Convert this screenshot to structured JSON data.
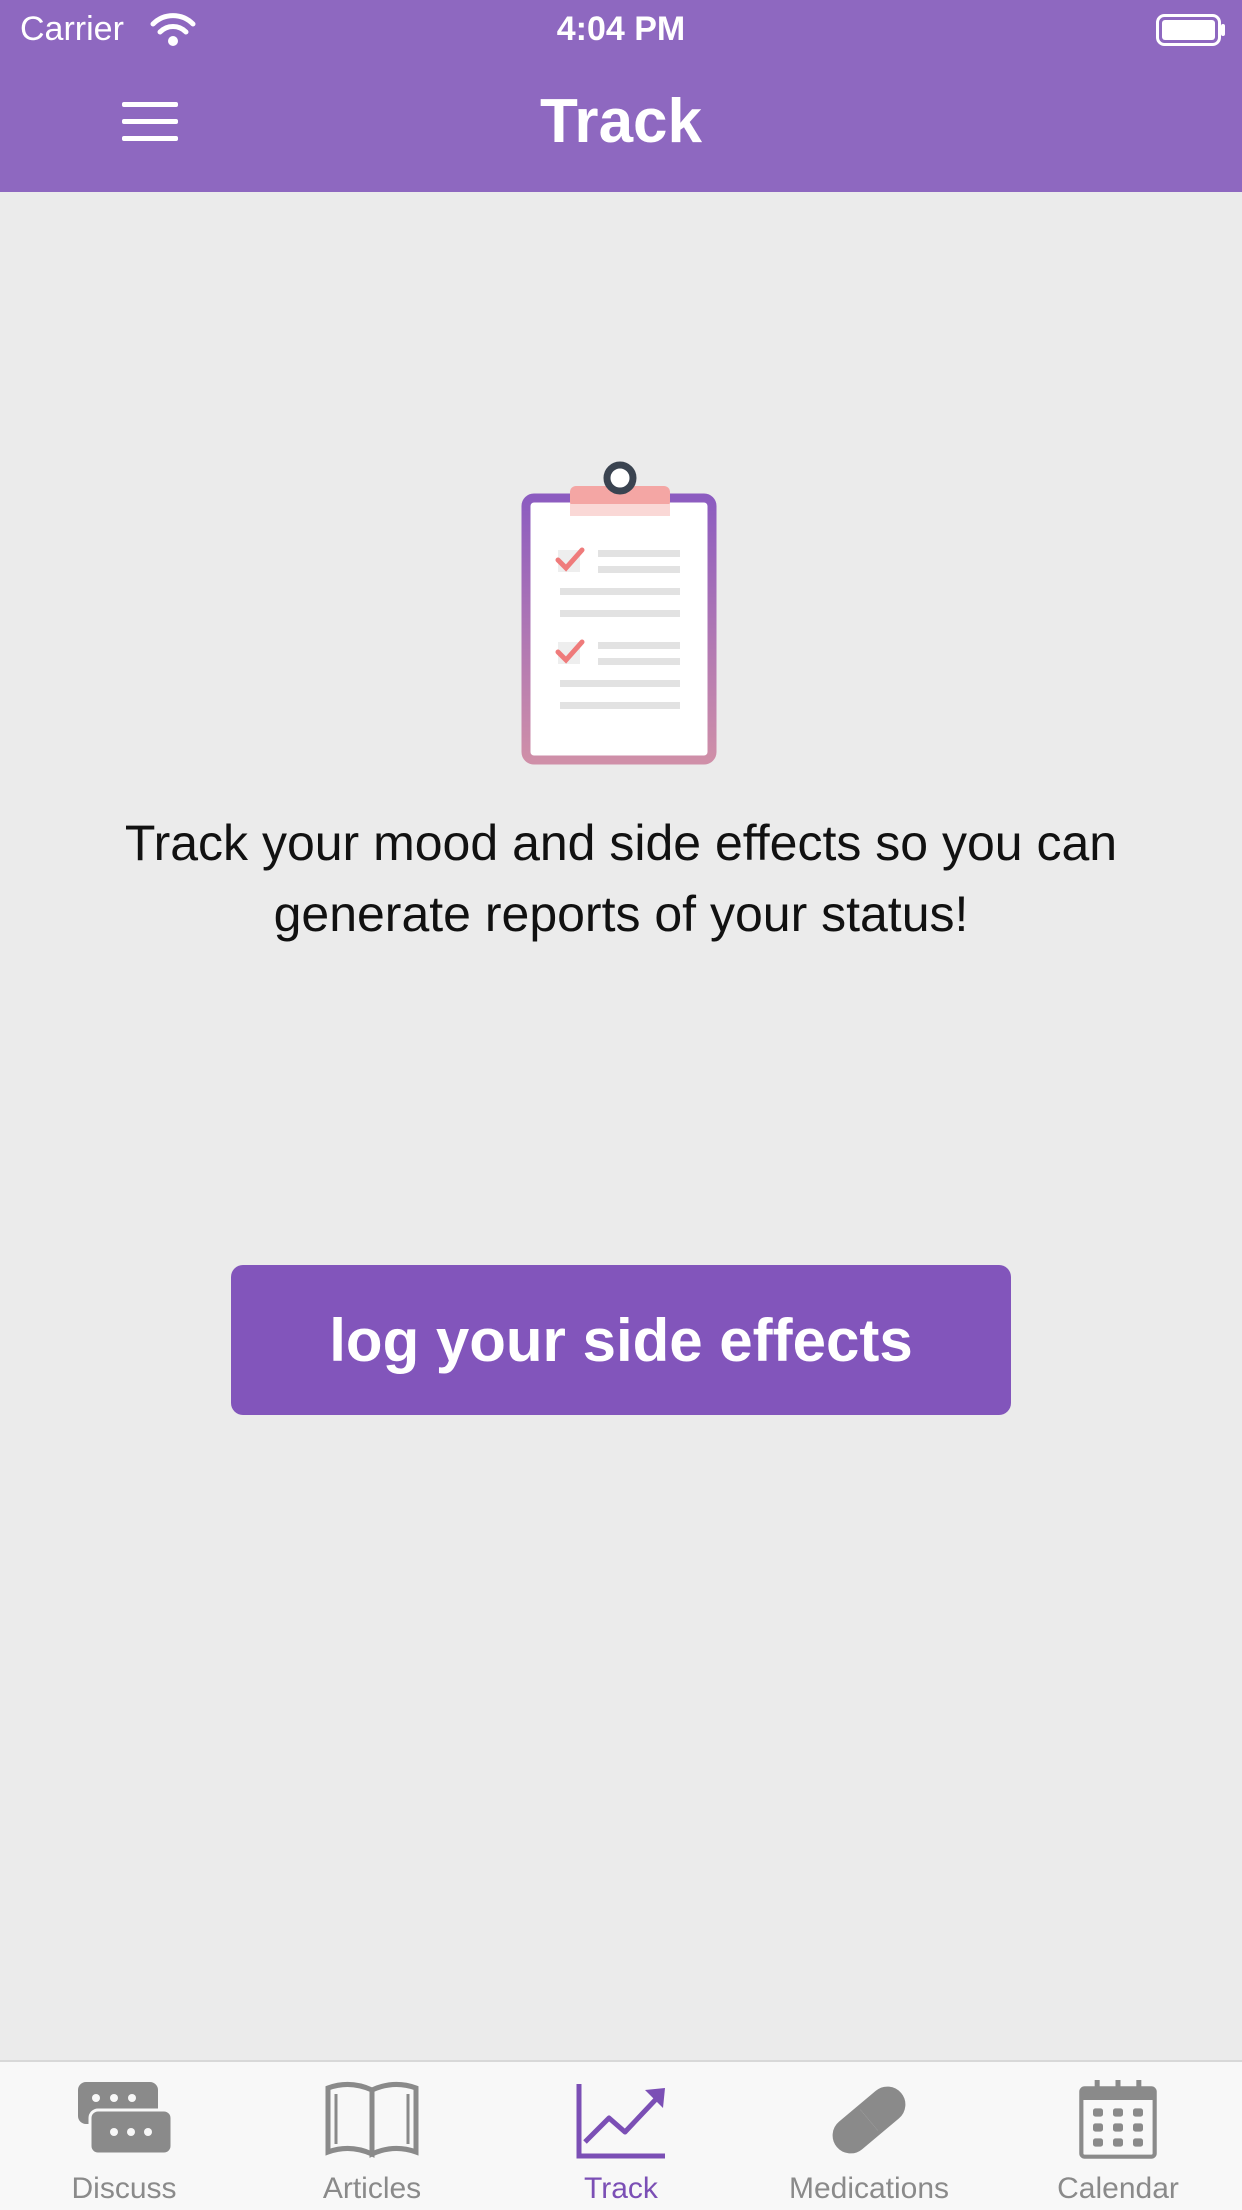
{
  "status_bar": {
    "carrier": "Carrier",
    "time": "4:04 PM"
  },
  "header": {
    "title": "Track"
  },
  "main": {
    "description": "Track your mood and side effects so you can generate reports of your status!",
    "cta_label": "log your side effects"
  },
  "tabs": [
    {
      "label": "Discuss",
      "icon": "chat-icon",
      "active": false
    },
    {
      "label": "Articles",
      "icon": "book-icon",
      "active": false
    },
    {
      "label": "Track",
      "icon": "chart-icon",
      "active": true
    },
    {
      "label": "Medications",
      "icon": "pill-icon",
      "active": false
    },
    {
      "label": "Calendar",
      "icon": "calendar-icon",
      "active": false
    }
  ],
  "colors": {
    "brand": "#8e68c0",
    "button": "#8255bb",
    "active_tab": "#7b4fb5",
    "inactive_tab": "#8a8a8a"
  }
}
